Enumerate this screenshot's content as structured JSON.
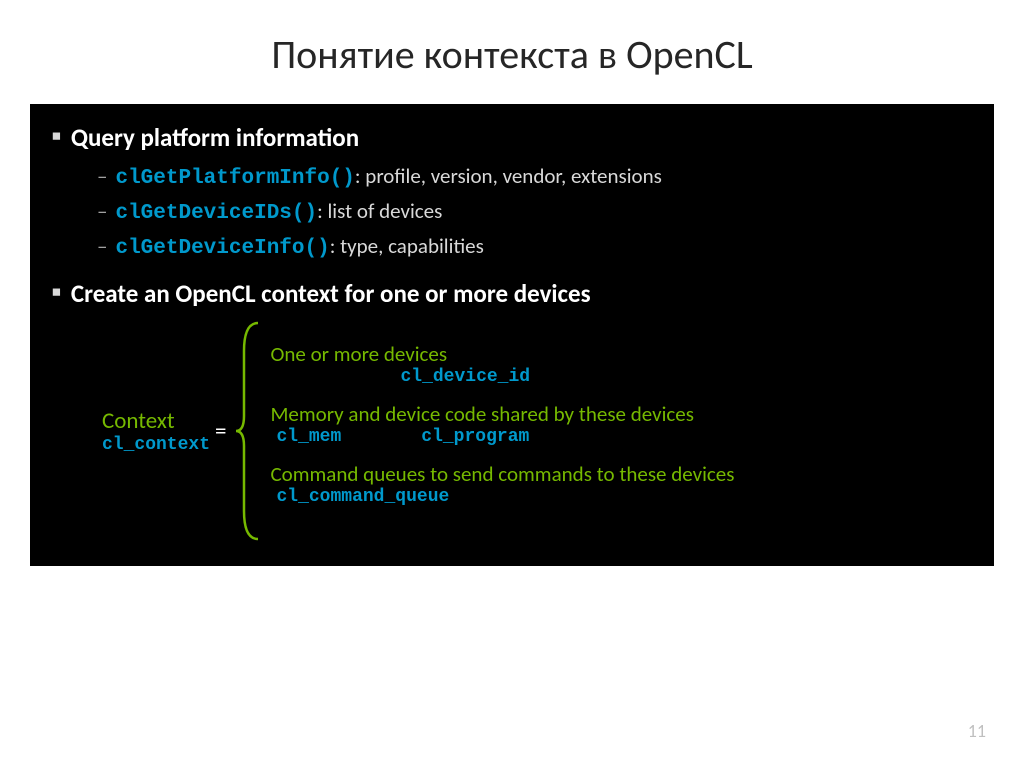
{
  "title": "Понятие контекста в OpenCL",
  "bullets": {
    "b1": "Query platform information",
    "b1_subs": {
      "s1_fn": "clGetPlatformInfo()",
      "s1_txt": ": profile, version, vendor, extensions",
      "s2_fn": "clGetDeviceIDs()",
      "s2_txt": ": list of devices",
      "s3_fn": "clGetDeviceInfo()",
      "s3_txt": ": type, capabilities"
    },
    "b2": "Create an OpenCL context for one or more devices"
  },
  "context": {
    "label": "Context",
    "label_code": "cl_context",
    "eq": "=",
    "block1": {
      "line1": "One or more devices",
      "line2": "cl_device_id"
    },
    "block2": {
      "line1": "Memory and device code shared by these devices",
      "line2a": "cl_mem",
      "line2b": "cl_program"
    },
    "block3": {
      "line1": "Command queues to send commands to these devices",
      "line2": "cl_command_queue"
    }
  },
  "page_number": "11"
}
